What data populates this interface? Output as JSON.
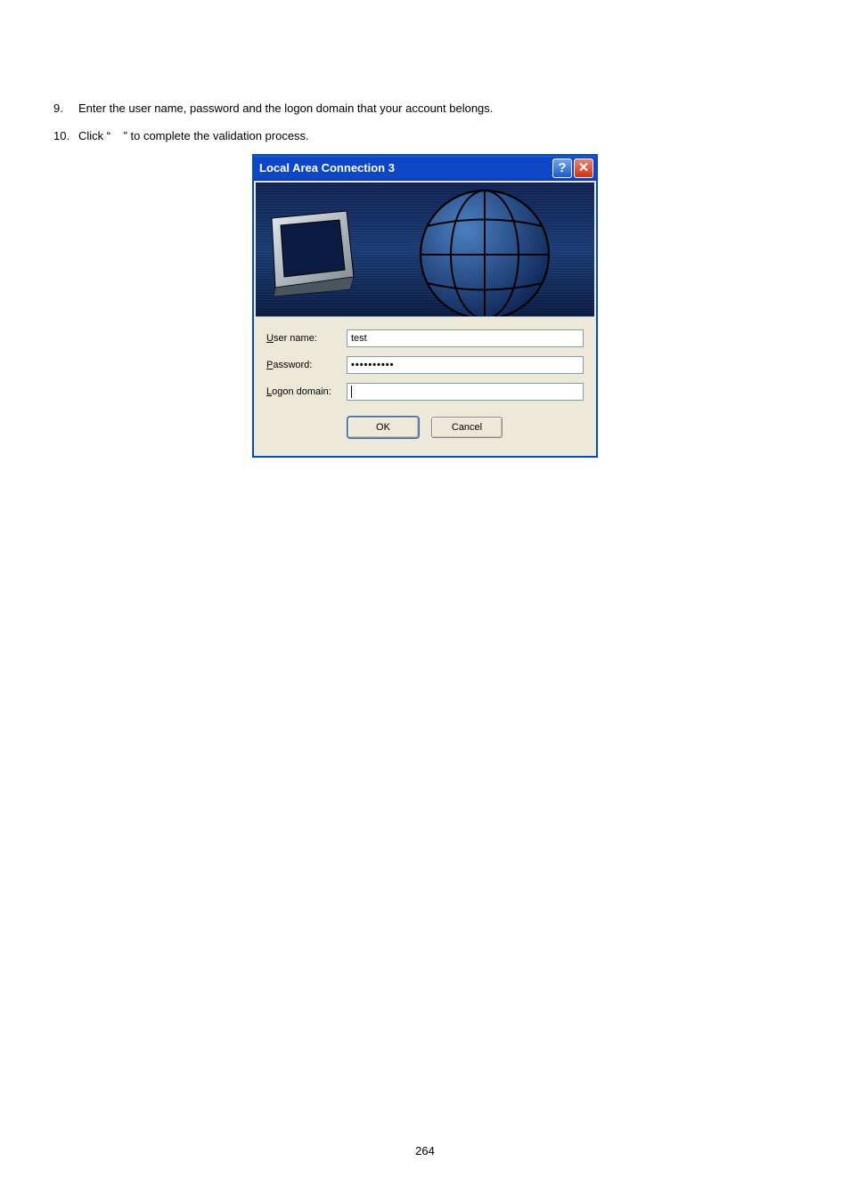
{
  "steps": {
    "s9_num": "9.",
    "s9_text": "Enter the user name, password and the logon domain that your account belongs.",
    "s10_num": "10.",
    "s10_text_a": "Click “",
    "s10_text_b": "” to complete the validation process."
  },
  "dialog": {
    "title": "Local Area Connection 3",
    "help_glyph": "?",
    "close_glyph": "✕",
    "labels": {
      "user_u": "U",
      "user_rest": "ser name:",
      "pass_p": "P",
      "pass_rest": "assword:",
      "logon_l": "L",
      "logon_rest": "ogon domain:"
    },
    "values": {
      "username": "test",
      "password_mask": "••••••••••",
      "logon": ""
    },
    "buttons": {
      "ok": "OK",
      "cancel": "Cancel"
    }
  },
  "page_number": "264"
}
